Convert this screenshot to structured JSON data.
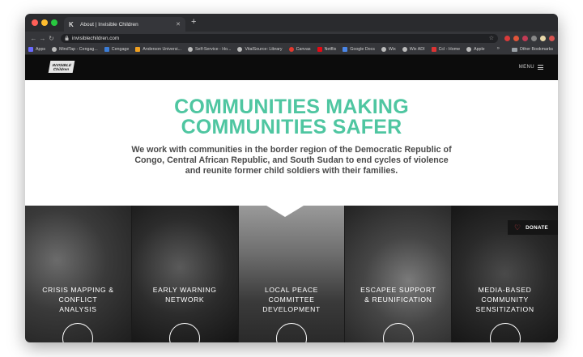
{
  "browser": {
    "tab_title": "About | Invisible Children",
    "tab_favicon": "K",
    "url": "invisiblechildren.com",
    "bookmarks": [
      "Apps",
      "MindTap - Cengag...",
      "Cengage",
      "Anderson Universi...",
      "Self-Service - Ho...",
      "VitalSource: Library",
      "Canvas",
      "Netflix",
      "Google Docs",
      "Wix",
      "Wix ADI",
      "Ccl - Home",
      "Apple"
    ],
    "bookmark_overflow": "»",
    "other_bookmarks": "Other Bookmarks"
  },
  "site": {
    "logo_line1": "INVISIBLE",
    "logo_line2": "Children",
    "menu_label": "MENU",
    "hero_title_line1": "COMMUNITIES MAKING",
    "hero_title_line2": "COMMUNITIES SAFER",
    "hero_text": "We work with communities in the border region of the Democratic Republic of Congo, Central African Republic, and South Sudan to end cycles of violence and reunite former child soldiers with their families.",
    "donate_label": "DONATE",
    "tiles": [
      {
        "line1": "CRISIS MAPPING &",
        "line2": "CONFLICT",
        "line3": "ANALYSIS"
      },
      {
        "line1": "EARLY WARNING",
        "line2": "NETWORK",
        "line3": ""
      },
      {
        "line1": "LOCAL PEACE",
        "line2": "COMMITTEE",
        "line3": "DEVELOPMENT"
      },
      {
        "line1": "ESCAPEE SUPPORT",
        "line2": "& REUNIFICATION",
        "line3": ""
      },
      {
        "line1": "MEDIA-BASED",
        "line2": "COMMUNITY",
        "line3": "SENSITIZATION"
      }
    ]
  },
  "colors": {
    "accent": "#4fc6a1",
    "header_bg": "#0c0c0c",
    "heart": "#e0424a"
  },
  "icons": [
    "back-icon",
    "forward-icon",
    "reload-icon",
    "lock-icon",
    "star-icon",
    "hamburger-icon",
    "heart-icon",
    "map-pin-icon",
    "refresh-icon",
    "laptop-icon",
    "home-icon",
    "fingerprint-icon"
  ]
}
